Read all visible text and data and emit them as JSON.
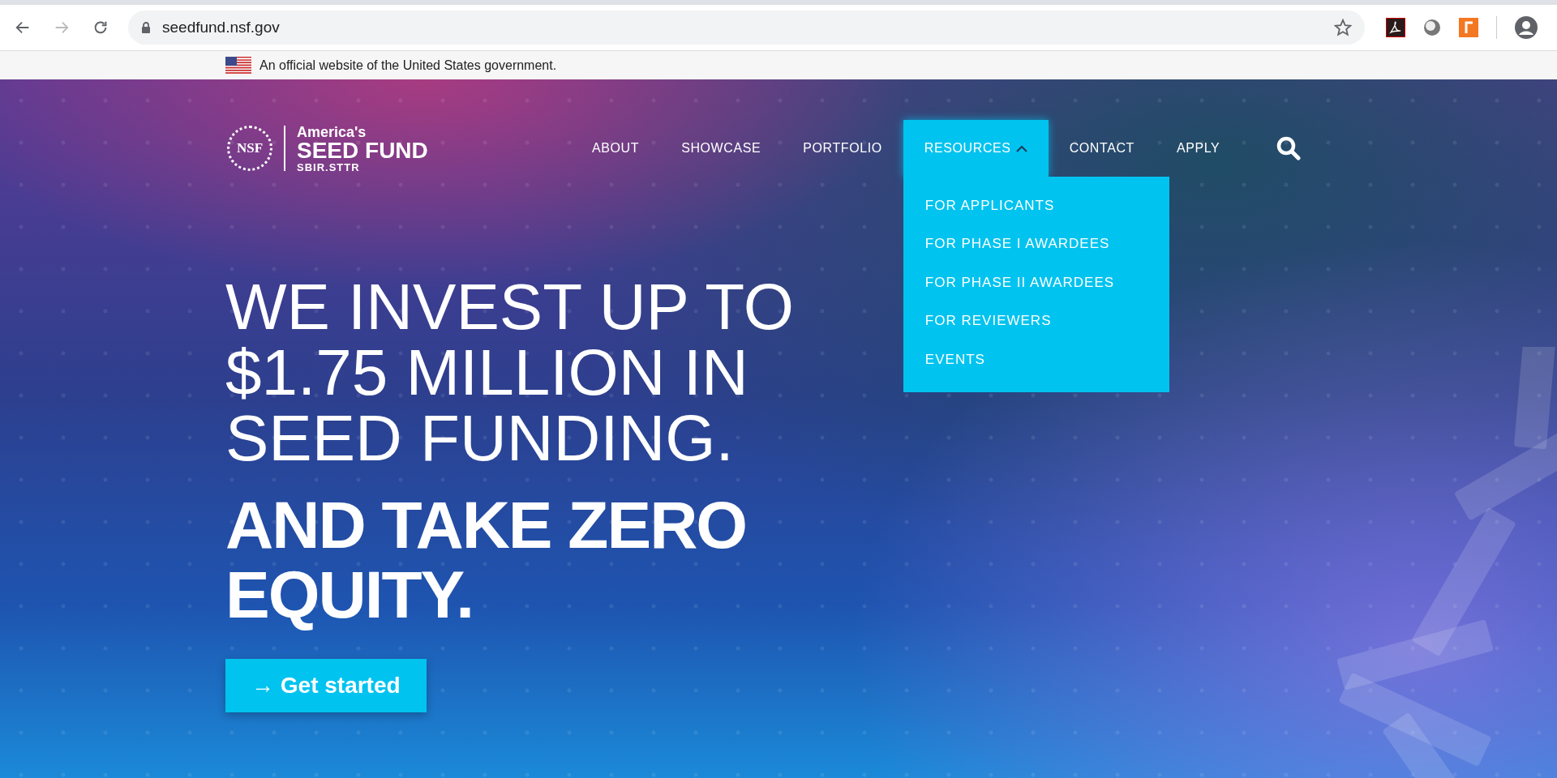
{
  "browser": {
    "url": "seedfund.nsf.gov"
  },
  "gov_banner": {
    "text": "An official website of the United States government."
  },
  "logo": {
    "seal": "NSF",
    "line_1": "America's",
    "line_2": "SEED FUND",
    "line_3": "SBIR.STTR"
  },
  "nav": [
    {
      "label": "ABOUT",
      "selected": false,
      "expanded": false
    },
    {
      "label": "SHOWCASE",
      "selected": false,
      "expanded": false
    },
    {
      "label": "PORTFOLIO",
      "selected": false,
      "expanded": false
    },
    {
      "label": "RESOURCES",
      "selected": true,
      "expanded": true
    },
    {
      "label": "CONTACT",
      "selected": false,
      "expanded": false
    },
    {
      "label": "APPLY",
      "selected": false,
      "expanded": false
    }
  ],
  "dropdown": [
    "FOR APPLICANTS",
    "FOR PHASE I AWARDEES",
    "FOR PHASE II AWARDEES",
    "FOR REVIEWERS",
    "EVENTS"
  ],
  "hero": {
    "headline": [
      "WE INVEST UP TO",
      "$1.75 MILLION IN",
      "SEED FUNDING."
    ],
    "subheadline": [
      "AND TAKE ZERO",
      "EQUITY."
    ],
    "button": "→ Get started"
  }
}
